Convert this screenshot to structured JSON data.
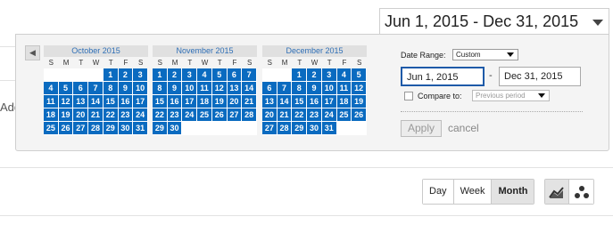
{
  "date_range_display": "Jun 1, 2015 - Dec 31, 2015",
  "background_text": "Add",
  "months": [
    {
      "title": "October 2015",
      "weekdays": [
        "S",
        "M",
        "T",
        "W",
        "T",
        "F",
        "S"
      ],
      "leading_blanks": 4,
      "days": [
        "1",
        "2",
        "3",
        "4",
        "5",
        "6",
        "7",
        "8",
        "9",
        "10",
        "11",
        "12",
        "13",
        "14",
        "15",
        "16",
        "17",
        "18",
        "19",
        "20",
        "21",
        "22",
        "23",
        "24",
        "25",
        "26",
        "27",
        "28",
        "29",
        "30",
        "31"
      ]
    },
    {
      "title": "November 2015",
      "weekdays": [
        "S",
        "M",
        "T",
        "W",
        "T",
        "F",
        "S"
      ],
      "leading_blanks": 0,
      "days": [
        "1",
        "2",
        "3",
        "4",
        "5",
        "6",
        "7",
        "8",
        "9",
        "10",
        "11",
        "12",
        "13",
        "14",
        "15",
        "16",
        "17",
        "18",
        "19",
        "20",
        "21",
        "22",
        "23",
        "24",
        "25",
        "26",
        "27",
        "28",
        "29",
        "30"
      ]
    },
    {
      "title": "December 2015",
      "weekdays": [
        "S",
        "M",
        "T",
        "W",
        "T",
        "F",
        "S"
      ],
      "leading_blanks": 2,
      "days": [
        "1",
        "2",
        "3",
        "4",
        "5",
        "6",
        "7",
        "8",
        "9",
        "10",
        "11",
        "12",
        "13",
        "14",
        "15",
        "16",
        "17",
        "18",
        "19",
        "20",
        "21",
        "22",
        "23",
        "24",
        "25",
        "26",
        "27",
        "28",
        "29",
        "30",
        "31"
      ]
    }
  ],
  "nav": {
    "prev": "◀",
    "next": "▶"
  },
  "controls": {
    "date_range_label": "Date Range:",
    "date_range_value": "Custom",
    "start_date": "Jun 1, 2015",
    "separator": "-",
    "end_date": "Dec 31, 2015",
    "compare_label": "Compare to:",
    "compare_value": "Previous period",
    "apply_label": "Apply",
    "cancel_label": "cancel"
  },
  "view_buttons": [
    {
      "label": "Day",
      "active": false
    },
    {
      "label": "Week",
      "active": false
    },
    {
      "label": "Month",
      "active": true
    }
  ],
  "chart_type_icons": [
    "line-chart-icon",
    "motion-chart-icon"
  ],
  "colors": {
    "selected_day": "#0a6bc0",
    "month_title": "#2f6fb6",
    "start_input_border": "#1e5aa8"
  }
}
